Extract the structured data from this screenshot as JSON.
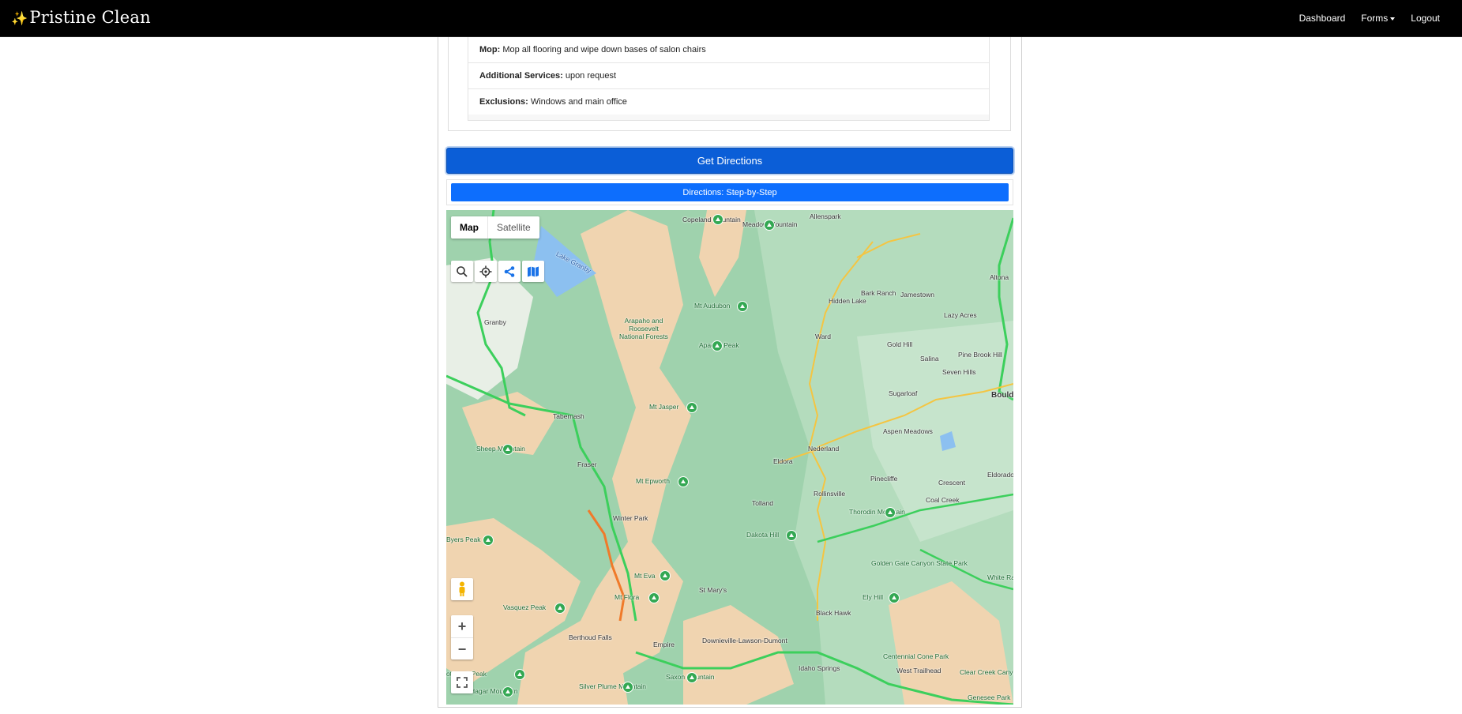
{
  "navbar": {
    "brand_icon": "✨",
    "brand": "Pristine Clean",
    "links": {
      "dashboard": "Dashboard",
      "forms": "Forms",
      "logout": "Logout"
    }
  },
  "details": [
    {
      "label": "Mop:",
      "value": "Mop all flooring and wipe down bases of salon chairs"
    },
    {
      "label": "Additional Services:",
      "value": "upon request"
    },
    {
      "label": "Exclusions:",
      "value": "Windows and main office"
    }
  ],
  "buttons": {
    "get_directions": "Get Directions",
    "step_by_step": "Directions: Step-by-Step"
  },
  "map": {
    "type_controls": {
      "map": "Map",
      "satellite": "Satellite"
    },
    "tools": [
      "search-icon",
      "locate-icon",
      "share-icon",
      "map-layers-icon"
    ],
    "zoom_in": "+",
    "zoom_out": "−",
    "colors": {
      "forest": "#9fd2ad",
      "terrain": "#f0d4b0",
      "highway": "#3ccf5c",
      "road": "#f4c542"
    },
    "labels": {
      "copeland": "Copeland Mountain",
      "meadow": "Meadow Mountain",
      "allenspark": "Allenspark",
      "lake_granby": "Lake Granby",
      "altona": "Altona",
      "mt_audubon": "Mt Audubon",
      "hidden_lake": "Hidden Lake",
      "bark_ranch": "Bark Ranch",
      "jamestown": "Jamestown",
      "lazy_acres": "Lazy Acres",
      "granby": "Granby",
      "arapaho": "Arapaho and Roosevelt National Forests",
      "apache_peak": "Apache Peak",
      "ward": "Ward",
      "gold_hill": "Gold Hill",
      "salina": "Salina",
      "pine_brook": "Pine Brook Hill",
      "seven_hills": "Seven Hills",
      "boulder": "Bould",
      "mt_jasper": "Mt Jasper",
      "tabernash": "Tabernash",
      "sugarloaf": "Sugarloaf",
      "aspen_meadows": "Aspen Meadows",
      "sheep_mountain": "Sheep Mountain",
      "fraser": "Fraser",
      "nederland": "Nederland",
      "eldora": "Eldora",
      "mt_epworth": "Mt Epworth",
      "pinecliffe": "Pinecliffe",
      "crescent": "Crescent",
      "eldorado": "Eldorado Springs",
      "rollinsville": "Rollinsville",
      "tolland": "Tolland",
      "coal_creek": "Coal Creek",
      "winter_park": "Winter Park",
      "thorodin": "Thorodin Mountain",
      "byers_peak": "Byers Peak",
      "dakota_hill": "Dakota Hill",
      "golden_gate": "Golden Gate Canyon State Park",
      "white_ranch": "White Ranch Park",
      "mt_eva": "Mt Eva",
      "st_marys": "St Mary's",
      "ely_hill": "Ely Hill",
      "mt_flora": "Mt Flora",
      "black_hawk": "Black Hawk",
      "vasquez_peak": "Vasquez Peak",
      "berthoud_falls": "Berthoud Falls",
      "empire": "Empire",
      "downieville": "Downieville-Lawson-Dumont",
      "centennial": "Centennial Cone Park",
      "west_trailhead": "West Trailhead",
      "idaho_springs": "Idaho Springs",
      "clear_creek": "Clear Creek Canyon Park",
      "bottingell": "ottingell Peak",
      "saxon": "Saxon Mountain",
      "silver_plume": "Silver Plume Mountain",
      "hagar": "Hagar Mountain",
      "genesee": "Genesee Park"
    }
  }
}
